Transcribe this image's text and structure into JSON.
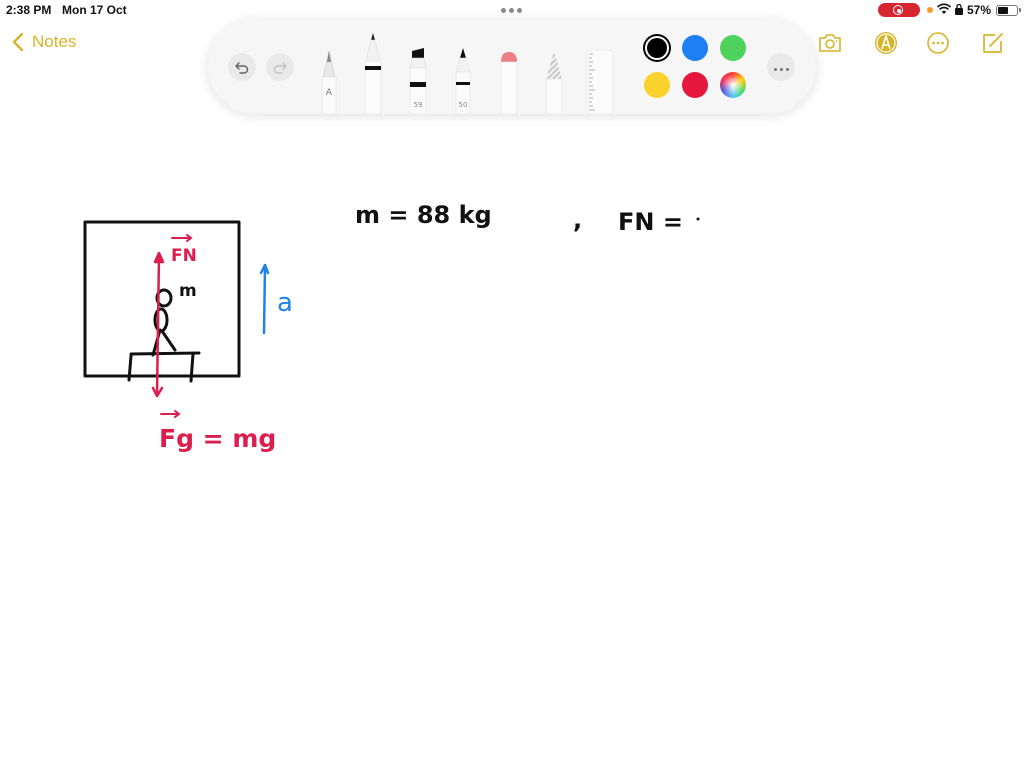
{
  "status_bar": {
    "time": "2:38 PM",
    "date": "Mon 17 Oct",
    "battery_percent": "57%",
    "battery_level": 0.57,
    "recording_color": "#d7262f",
    "indicator_dot_color": "#f29b28"
  },
  "nav": {
    "back_label": "Notes",
    "accent_color": "#d6b42a",
    "icons": [
      "camera-icon",
      "markup-icon",
      "more-icon",
      "compose-icon"
    ]
  },
  "tool_palette": {
    "undo_icon": "undo-icon",
    "redo_icon": "redo-icon",
    "tools": [
      {
        "name": "monoline-pen",
        "label": "A"
      },
      {
        "name": "pen",
        "label": ""
      },
      {
        "name": "marker",
        "label": "59"
      },
      {
        "name": "fountain-pen",
        "label": "50"
      },
      {
        "name": "eraser",
        "label": ""
      },
      {
        "name": "pencil",
        "label": ""
      },
      {
        "name": "ruler",
        "label": ""
      }
    ],
    "colors": [
      {
        "name": "black",
        "hex": "#000000",
        "selected": true
      },
      {
        "name": "blue",
        "hex": "#1e7ef5",
        "selected": false
      },
      {
        "name": "green",
        "hex": "#4fd15d",
        "selected": false
      },
      {
        "name": "yellow",
        "hex": "#fbd22d",
        "selected": false
      },
      {
        "name": "red",
        "hex": "#e5173f",
        "selected": false
      },
      {
        "name": "multicolor",
        "hex": "conic",
        "selected": false
      }
    ],
    "more_icon": "ellipsis-icon"
  },
  "note": {
    "handwriting": {
      "equation_1": "m = 88 kg",
      "separator": ",",
      "equation_2": "FN =",
      "label_normal_force": "FN",
      "label_mass": "m",
      "label_acceleration": "a",
      "label_gravity": "Fg = mg"
    },
    "ink_colors": {
      "black": "#111111",
      "red": "#dc1e4e",
      "blue": "#1f83e6"
    }
  }
}
